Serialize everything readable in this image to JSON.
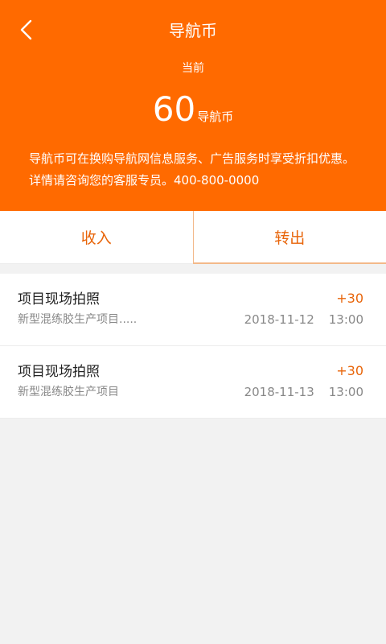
{
  "header": {
    "title": "导航币",
    "back_icon": "chevron-left-icon",
    "current_label": "当前",
    "balance_value": "60",
    "balance_unit": "导航币",
    "desc_line1": "导航币可在换购导航网信息服务、广告服务时享受折扣优惠。",
    "desc_line2": "详情请咨询您的客服专员。400-800-0000",
    "bg_color": "#ff6a00"
  },
  "tabs": [
    {
      "label": "收入"
    },
    {
      "label": "转出"
    }
  ],
  "records": [
    {
      "title": "项目现场拍照",
      "amount": "+30",
      "subtitle": "新型混练胶生产项目.....",
      "date": "2018-11-12",
      "time": "13:00"
    },
    {
      "title": "项目现场拍照",
      "amount": "+30",
      "subtitle": "新型混练胶生产项目",
      "date": "2018-11-13",
      "time": "13:00"
    }
  ],
  "accent_color": "#e8650a"
}
